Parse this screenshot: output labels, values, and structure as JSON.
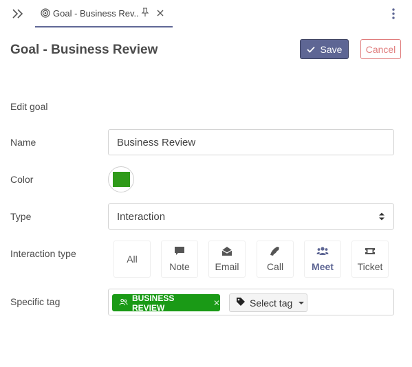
{
  "tab": {
    "title": "Goal - Business Rev...",
    "icon": "target-icon"
  },
  "header": {
    "title": "Goal - Business Review",
    "save_label": "Save",
    "cancel_label": "Cancel"
  },
  "form": {
    "section_title": "Edit goal",
    "name_label": "Name",
    "name_value": "Business Review",
    "color_label": "Color",
    "color_value": "#2f9a19",
    "type_label": "Type",
    "type_value": "Interaction",
    "interaction_type_label": "Interaction type",
    "interaction_types": [
      {
        "label": "All",
        "icon": ""
      },
      {
        "label": "Note",
        "icon": "comment-icon"
      },
      {
        "label": "Email",
        "icon": "envelope-open-icon"
      },
      {
        "label": "Call",
        "icon": "phone-icon"
      },
      {
        "label": "Meet",
        "icon": "users-icon",
        "selected": true
      },
      {
        "label": "Ticket",
        "icon": "ticket-icon"
      }
    ],
    "specific_tag_label": "Specific tag",
    "selected_tag": "BUSINESS REVIEW",
    "selected_tag_color": "#1a9a16",
    "select_tag_label": "Select tag"
  },
  "colors": {
    "accent": "#5e6694",
    "danger": "#e07c7c"
  }
}
